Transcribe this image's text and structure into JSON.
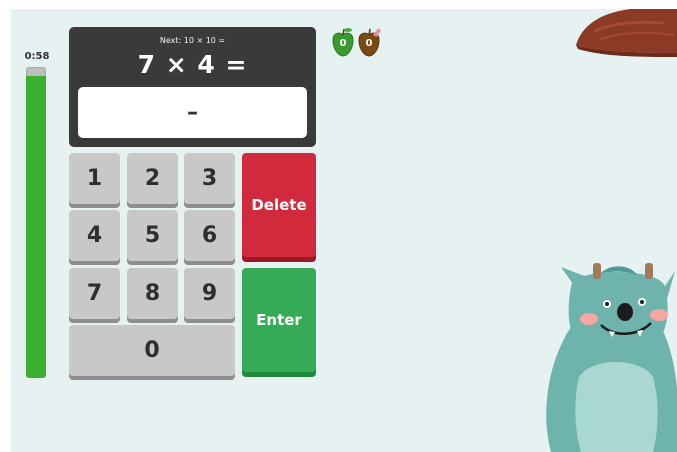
{
  "timer": {
    "label": "0:58",
    "remaining_fraction": 0.97
  },
  "display": {
    "next_question": "Next: 10 × 10 =",
    "question": "7 × 4 =",
    "answer": "–"
  },
  "keypad": {
    "keys": [
      "1",
      "2",
      "3",
      "4",
      "5",
      "6",
      "7",
      "8",
      "9",
      "0"
    ],
    "delete_label": "Delete",
    "enter_label": "Enter"
  },
  "score": {
    "green_apple_count": "0",
    "rotten_apple_count": "0"
  },
  "colors": {
    "timer_green": "#3bb02f",
    "delete_red": "#d12a3c",
    "enter_green": "#35ab58",
    "display_dark": "#3a3a3a",
    "background": "#e6f2f2"
  },
  "icons": [
    "green-apple-icon",
    "rotten-apple-icon",
    "mushroom-cap-decoration",
    "monster-character"
  ]
}
